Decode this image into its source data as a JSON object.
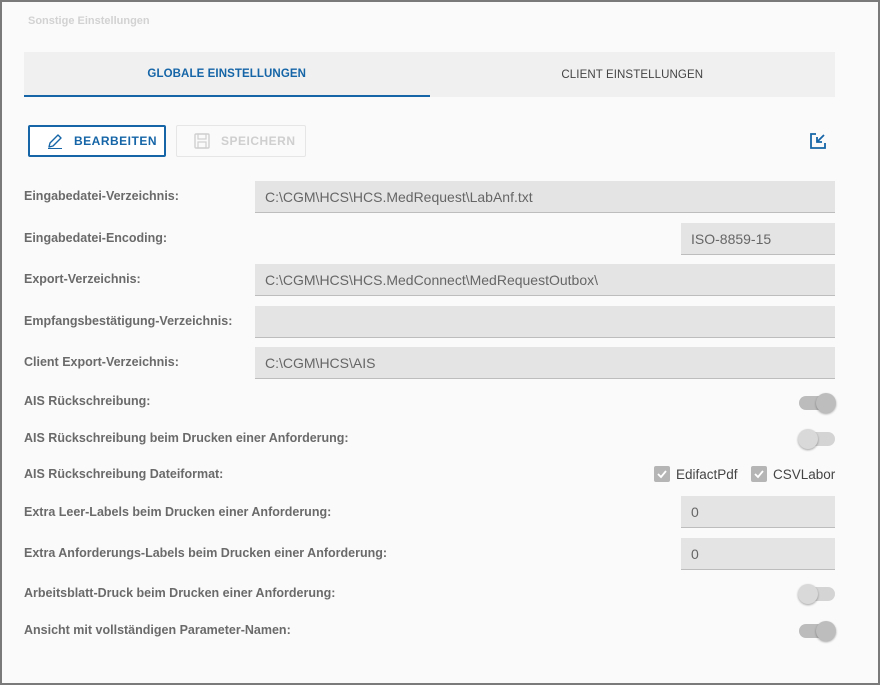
{
  "section_title": "Sonstige Einstellungen",
  "tabs": [
    {
      "label": "GLOBALE EINSTELLUNGEN",
      "active": true
    },
    {
      "label": "CLIENT EINSTELLUNGEN",
      "active": false
    }
  ],
  "toolbar": {
    "edit_label": "BEARBEITEN",
    "save_label": "SPEICHERN",
    "export_icon": "export-icon"
  },
  "fields": {
    "input_dir": {
      "label": "Eingabedatei-Verzeichnis:",
      "value": "C:\\CGM\\HCS\\HCS.MedRequest\\LabAnf.txt"
    },
    "input_encoding": {
      "label": "Eingabedatei-Encoding:",
      "value": "ISO-8859-15"
    },
    "export_dir": {
      "label": "Export-Verzeichnis:",
      "value": "C:\\CGM\\HCS\\HCS.MedConnect\\MedRequestOutbox\\"
    },
    "receipt_dir": {
      "label": "Empfangsbestätigung-Verzeichnis:",
      "value": ""
    },
    "client_export_dir": {
      "label": "Client Export-Verzeichnis:",
      "value": "C:\\CGM\\HCS\\AIS"
    },
    "ais_writeback": {
      "label": "AIS Rückschreibung:",
      "on": true
    },
    "ais_writeback_print": {
      "label": "AIS Rückschreibung beim Drucken einer Anforderung:",
      "on": false
    },
    "ais_format": {
      "label": "AIS Rückschreibung Dateiformat:",
      "options": [
        {
          "label": "EdifactPdf",
          "checked": true
        },
        {
          "label": "CSVLabor",
          "checked": true
        }
      ]
    },
    "extra_empty_labels": {
      "label": "Extra Leer-Labels beim Drucken einer Anforderung:",
      "value": "0"
    },
    "extra_request_labels": {
      "label": "Extra Anforderungs-Labels beim Drucken einer Anforderung:",
      "value": "0"
    },
    "worksheet_print": {
      "label": "Arbeitsblatt-Druck beim Drucken einer Anforderung:",
      "on": false
    },
    "full_param_names": {
      "label": "Ansicht mit vollständigen Parameter-Namen:",
      "on": true
    }
  },
  "colors": {
    "accent": "#1565a7",
    "field_bg": "#e4e4e4",
    "label": "#6a6a6a"
  }
}
